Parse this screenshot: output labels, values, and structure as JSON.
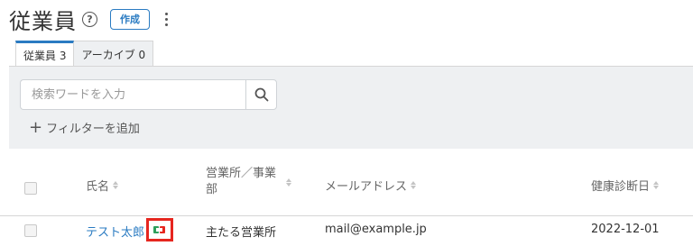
{
  "header": {
    "title": "従業員",
    "help_icon": "question-circle-icon",
    "create_label": "作成",
    "more_icon": "kebab-menu-icon"
  },
  "tabs": [
    {
      "label": "従業員 3",
      "active": true
    },
    {
      "label": "アーカイブ 0",
      "active": false
    }
  ],
  "search": {
    "placeholder": "検索ワードを入力",
    "value": "",
    "button_icon": "search-icon"
  },
  "filter": {
    "add_label": "フィルターを追加",
    "icon": "plus-icon"
  },
  "table": {
    "columns": [
      "氏名",
      "営業所／事業部",
      "メールアドレス",
      "健康診断日"
    ],
    "rows": [
      {
        "name": "テスト太郎",
        "office": "主たる営業所",
        "email": "mail@example.jp",
        "checkup_date": "2022-12-01",
        "badge_icon": "contact-badge-icon"
      }
    ]
  },
  "colors": {
    "accent": "#2a7bc2",
    "highlight": "#e6261f",
    "panel_bg": "#eef0f2"
  }
}
